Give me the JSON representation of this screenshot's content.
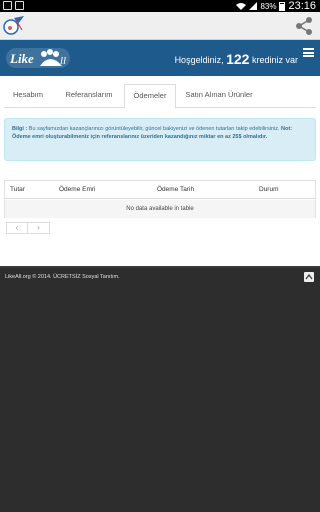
{
  "status_bar": {
    "battery": "83%",
    "time": "23:16"
  },
  "icons": {
    "app": "likeall-app-icon",
    "share": "share-icon",
    "menu": "hamburger-menu-icon",
    "scroll_top": "chevron-up-icon"
  },
  "header": {
    "logo_text": "LikeAll",
    "welcome_prefix": "Hoşgeldiniz,",
    "credits": "122",
    "welcome_suffix": "krediniz var"
  },
  "tabs": [
    {
      "label": "Hesabım",
      "active": false
    },
    {
      "label": "Referanslarım",
      "active": false
    },
    {
      "label": "Ödemeler",
      "active": true
    },
    {
      "label": "Satın Alınan Ürünler",
      "active": false
    }
  ],
  "alert": {
    "title": "Bilgi :",
    "text": " Bu sayfamızdan kazançlarınızı görüntüleyebilir, güncel bakiyenizi ve ödenen tutarları takip edebilirsiniz.",
    "note": "Not: Ödeme emri oluşturabilmeniz için referanslarınız üzeriden kazandığınız miktar en az 25$ olmalıdır."
  },
  "table": {
    "columns": [
      "Tutar",
      "Ödeme Emri",
      "Ödeme Tarih",
      "Durum"
    ],
    "empty_message": "No data available in table"
  },
  "pagination": {
    "prev": "‹",
    "next": "›"
  },
  "footer": {
    "text": "LikeAll.org © 2014. ÜCRETSİZ Sosyal Tanıtım."
  },
  "colors": {
    "header_bg": "#1f5a8d",
    "alert_bg": "#d9edf7",
    "alert_text": "#31708f",
    "footer_bg": "#2d2d2d"
  }
}
